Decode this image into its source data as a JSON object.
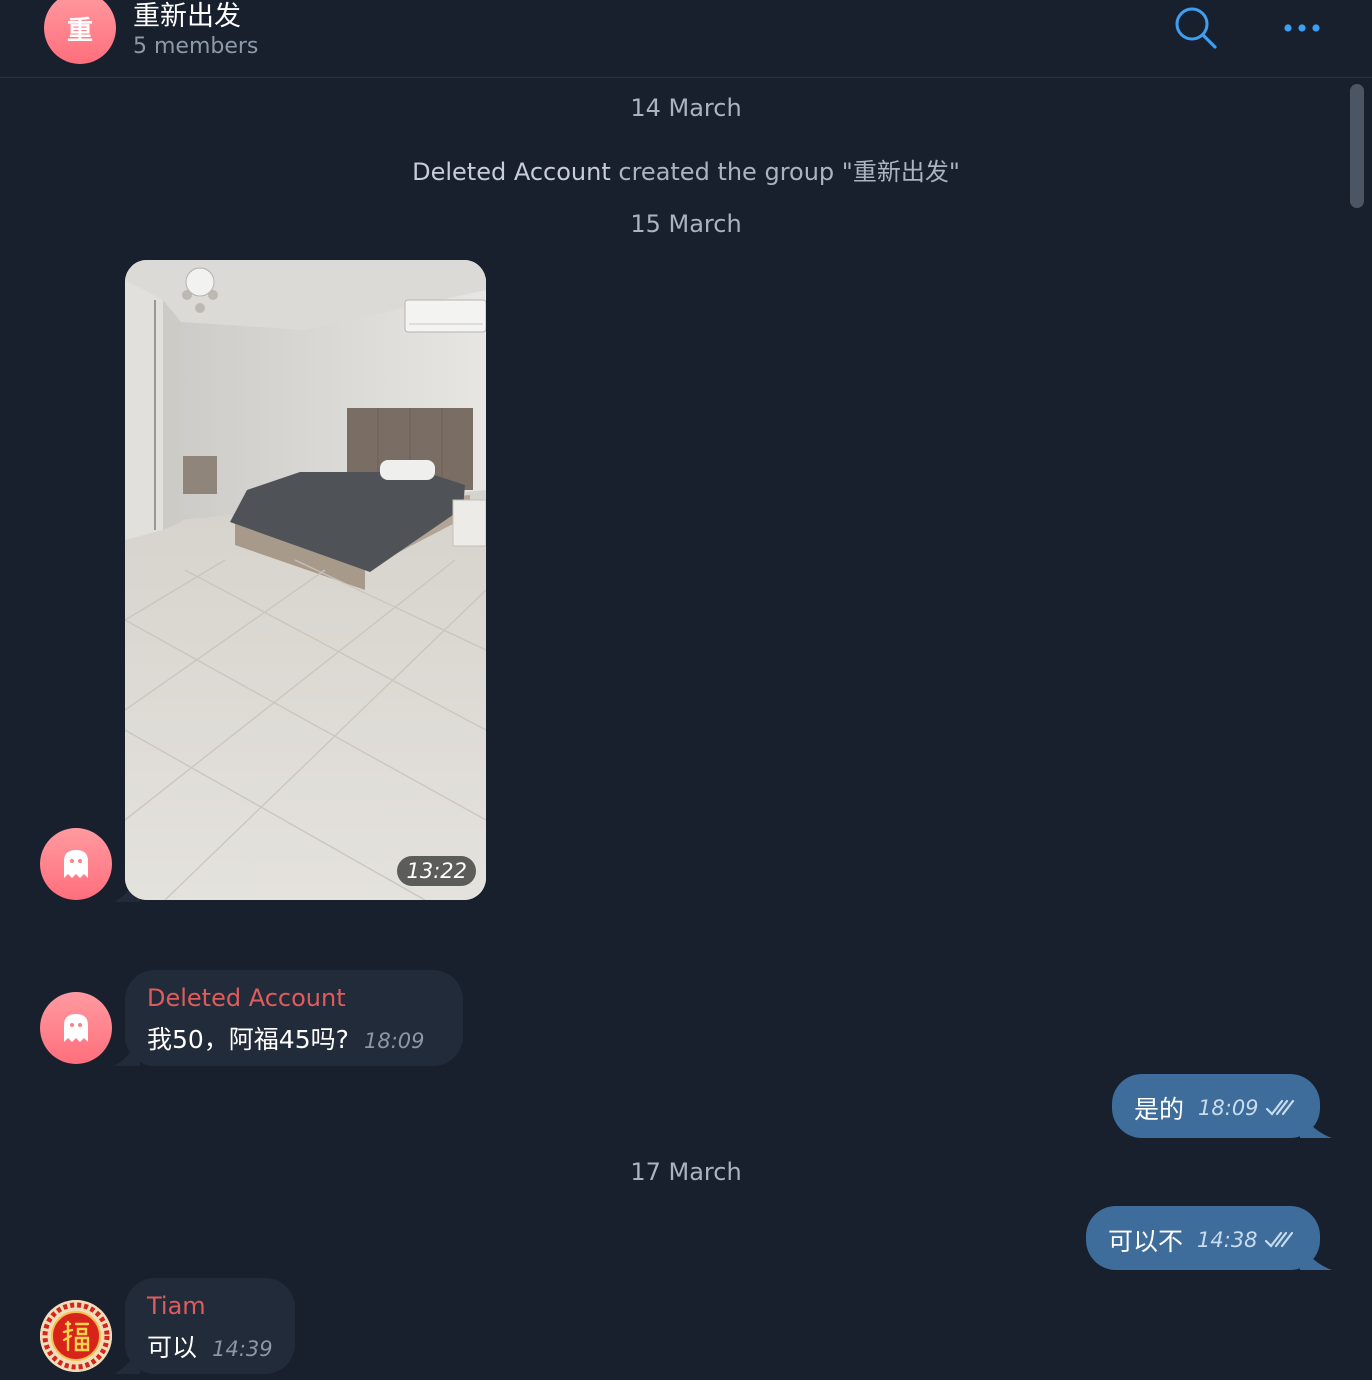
{
  "header": {
    "avatar_letter": "重",
    "title": "重新出发",
    "subtitle": "5 members",
    "search_icon": "search-icon",
    "more_icon": "more-dots-icon",
    "accent_color": "#3d9ff2"
  },
  "service": {
    "date1": "14 March",
    "created_actor": "Deleted Account",
    "created_text": "created the group \"重新出发\"",
    "date2": "15 March",
    "date3": "17 March"
  },
  "messages": {
    "photo": {
      "time": "13:22",
      "avatar_icon": "ghost-icon"
    },
    "m1": {
      "sender": "Deleted Account",
      "text": "我50，阿福45吗?",
      "time": "18:09"
    },
    "m2": {
      "text": "是的",
      "time": "18:09",
      "status_icon": "double-check-icon"
    },
    "m3": {
      "text": "可以不",
      "time": "14:38",
      "status_icon": "double-check-icon"
    },
    "m4": {
      "sender": "Tiam",
      "text": "可以",
      "time": "14:39",
      "avatar_icon": "fu-avatar-icon"
    }
  },
  "colors": {
    "background": "#18202e",
    "incoming_bubble": "#222b3a",
    "outgoing_bubble": "#3e6d9c",
    "sender_name": "#e05c5c"
  }
}
